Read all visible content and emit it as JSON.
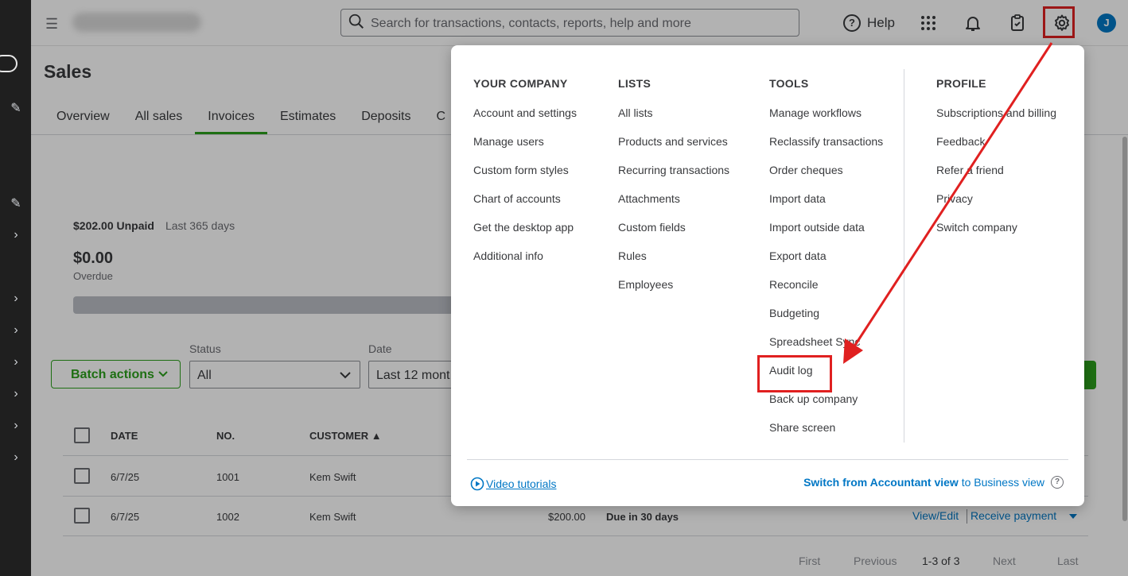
{
  "header": {
    "search_placeholder": "Search for transactions, contacts, reports, help and more",
    "help_label": "Help",
    "avatar_initial": "J"
  },
  "page": {
    "title": "Sales",
    "tabs": [
      {
        "label": "Overview"
      },
      {
        "label": "All sales"
      },
      {
        "label": "Invoices",
        "active": true
      },
      {
        "label": "Estimates"
      },
      {
        "label": "Deposits"
      },
      {
        "label": "C"
      }
    ]
  },
  "summary": {
    "unpaid": "$202.00 Unpaid",
    "period": "Last 365 days",
    "overdue_amount": "$0.00",
    "overdue_label": "Overdue"
  },
  "filters": {
    "batch_label": "Batch actions",
    "status_label": "Status",
    "status_value": "All",
    "date_label": "Date",
    "date_value": "Last 12 mont"
  },
  "table": {
    "headers": {
      "date": "DATE",
      "no": "NO.",
      "customer": "CUSTOMER ▲"
    },
    "rows": [
      {
        "date": "6/7/25",
        "no": "1001",
        "customer": "Kem Swift",
        "amount": "",
        "status": "",
        "view": "",
        "receive": ""
      },
      {
        "date": "6/7/25",
        "no": "1002",
        "customer": "Kem Swift",
        "amount": "$200.00",
        "status": "Due in 30 days",
        "view": "View/Edit",
        "receive": "Receive payment"
      }
    ]
  },
  "pager": {
    "first": "First",
    "previous": "Previous",
    "range": "1-3 of 3",
    "next": "Next",
    "last": "Last"
  },
  "menu": {
    "your_company": {
      "heading": "YOUR COMPANY",
      "items": [
        "Account and settings",
        "Manage users",
        "Custom form styles",
        "Chart of accounts",
        "Get the desktop app",
        "Additional info"
      ]
    },
    "lists": {
      "heading": "LISTS",
      "items": [
        "All lists",
        "Products and services",
        "Recurring transactions",
        "Attachments",
        "Custom fields",
        "Rules",
        "Employees"
      ]
    },
    "tools": {
      "heading": "TOOLS",
      "items": [
        "Manage workflows",
        "Reclassify transactions",
        "Order cheques",
        "Import data",
        "Import outside data",
        "Export data",
        "Reconcile",
        "Budgeting",
        "Spreadsheet Sync",
        "Audit log",
        "Back up company",
        "Share screen"
      ]
    },
    "profile": {
      "heading": "PROFILE",
      "items": [
        "Subscriptions and billing",
        "Feedback",
        "Refer a friend",
        "Privacy",
        "Switch company"
      ]
    },
    "footer": {
      "video_tutorials": "Video tutorials",
      "switch_bold": "Switch from Accountant view",
      "switch_rest": "to Business view"
    }
  },
  "colors": {
    "brand_green": "#2ca01c",
    "link_blue": "#0077c5",
    "annotation_red": "#e02020"
  }
}
